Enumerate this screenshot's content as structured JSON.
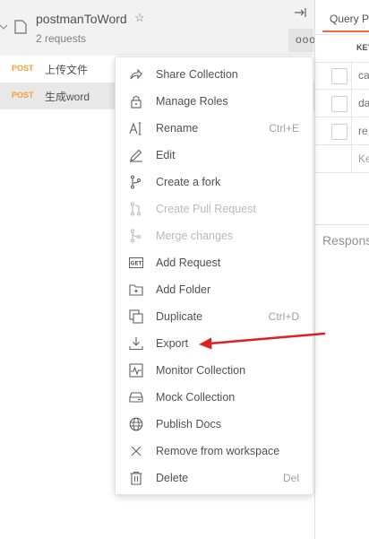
{
  "collection": {
    "name": "postmanToWord",
    "star_icon": "star-icon",
    "request_count": "2 requests",
    "more_label": "ooo"
  },
  "requests": [
    {
      "method": "POST",
      "name": "上传文件",
      "selected": false
    },
    {
      "method": "POST",
      "name": "生成word",
      "selected": true
    }
  ],
  "right_pane": {
    "tab_label": "Query Pa",
    "key_header": "KEY",
    "rows": [
      "ca",
      "da",
      "re"
    ],
    "placeholder": "Ke",
    "response_label": "Respons"
  },
  "menu": {
    "items": [
      {
        "label": "Share Collection",
        "shortcut": "",
        "icon": "share-icon",
        "disabled": false
      },
      {
        "label": "Manage Roles",
        "shortcut": "",
        "icon": "lock-icon",
        "disabled": false
      },
      {
        "label": "Rename",
        "shortcut": "Ctrl+E",
        "icon": "rename-icon",
        "disabled": false
      },
      {
        "label": "Edit",
        "shortcut": "",
        "icon": "pencil-icon",
        "disabled": false
      },
      {
        "label": "Create a fork",
        "shortcut": "",
        "icon": "fork-icon",
        "disabled": false
      },
      {
        "label": "Create Pull Request",
        "shortcut": "",
        "icon": "pull-request-icon",
        "disabled": true
      },
      {
        "label": "Merge changes",
        "shortcut": "",
        "icon": "merge-icon",
        "disabled": true
      },
      {
        "label": "Add Request",
        "shortcut": "",
        "icon": "get-request-icon",
        "disabled": false
      },
      {
        "label": "Add Folder",
        "shortcut": "",
        "icon": "add-folder-icon",
        "disabled": false
      },
      {
        "label": "Duplicate",
        "shortcut": "Ctrl+D",
        "icon": "duplicate-icon",
        "disabled": false
      },
      {
        "label": "Export",
        "shortcut": "",
        "icon": "download-icon",
        "disabled": false
      },
      {
        "label": "Monitor Collection",
        "shortcut": "",
        "icon": "monitor-icon",
        "disabled": false
      },
      {
        "label": "Mock Collection",
        "shortcut": "",
        "icon": "server-icon",
        "disabled": false
      },
      {
        "label": "Publish Docs",
        "shortcut": "",
        "icon": "globe-icon",
        "disabled": false
      },
      {
        "label": "Remove from workspace",
        "shortcut": "",
        "icon": "close-icon",
        "disabled": false
      },
      {
        "label": "Delete",
        "shortcut": "Del",
        "icon": "trash-icon",
        "disabled": false
      }
    ]
  },
  "get_badge_text": "GET",
  "colors": {
    "accent": "#f26b3a",
    "method_post": "#f0a030",
    "annotation_arrow": "#e02020"
  }
}
